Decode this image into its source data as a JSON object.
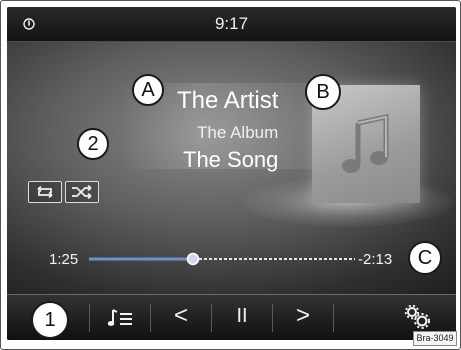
{
  "status_bar": {
    "time": "9:17",
    "status_icon": "navigation-indicator-icon"
  },
  "now_playing": {
    "artist": "The Artist",
    "album": "The Album",
    "song": "The Song",
    "cover_icon": "music-note-icon"
  },
  "play_modes": {
    "repeat_icon": "repeat-icon",
    "shuffle_icon": "shuffle-icon"
  },
  "progress": {
    "elapsed": "1:25",
    "remaining": "-2:13",
    "position_fraction": 0.39,
    "played_color": "#6f8fd0"
  },
  "bottom_bar": {
    "items": [
      {
        "label": "",
        "icon": "menu-icon"
      },
      {
        "label": "",
        "icon": "playlist-icon"
      },
      {
        "label": "<",
        "icon": "previous-track-icon"
      },
      {
        "label": "II",
        "icon": "pause-icon"
      },
      {
        "label": ">",
        "icon": "next-track-icon"
      },
      {
        "label": "",
        "icon": "settings-icon"
      }
    ]
  },
  "callouts": {
    "a": "A",
    "b": "B",
    "c": "C",
    "one": "1",
    "two": "2"
  },
  "figure_code": "Bra-3049"
}
